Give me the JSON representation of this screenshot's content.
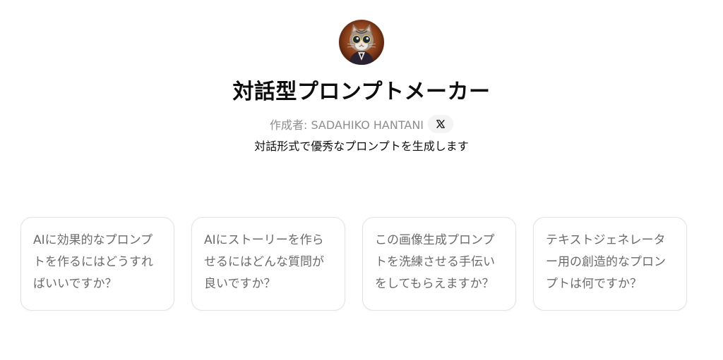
{
  "gpt": {
    "title": "対話型プロンプトメーカー",
    "author": "作成者: SADAHIKO HANTANI",
    "description": "対話形式で優秀なプロンプトを生成します",
    "avatar_icon": "cat-with-glasses-avatar",
    "social_icon": "x-logo-icon"
  },
  "conversation_starters": [
    {
      "text": "AIに効果的なプロンプトを作るにはどうすればいいですか？"
    },
    {
      "text": "AIにストーリーを作らせるにはどんな質問が良いですか？"
    },
    {
      "text": "この画像生成プロンプトを洗練させる手伝いをしてもらえますか？"
    },
    {
      "text": "テキストジェネレーター用の創造的なプロンプトは何ですか？"
    }
  ],
  "colors": {
    "title": "#0d0d0d",
    "muted": "#8e8e8e",
    "card_text": "#6b6b6b",
    "card_border": "#e3e3e3",
    "badge_bg": "#f3f3f3"
  }
}
